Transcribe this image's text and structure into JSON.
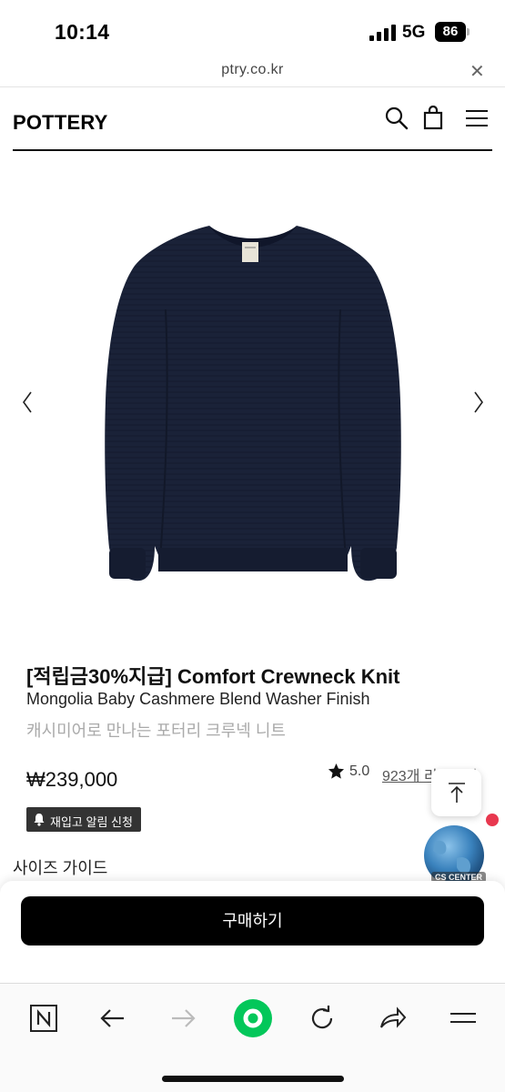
{
  "status_bar": {
    "time": "10:14",
    "network": "5G",
    "battery": "86"
  },
  "url_bar": {
    "domain": "ptry.co.kr",
    "close_glyph": "✕"
  },
  "header": {
    "logo": "POTTERY",
    "icons": [
      "search-icon",
      "shopping-bag-icon",
      "hamburger-menu-icon"
    ]
  },
  "gallery": {
    "image_subject": "navy crewneck knit sweater",
    "prev_glyph": "prev-chevron",
    "next_glyph": "next-chevron"
  },
  "product": {
    "title": "[적립금30%지급] Comfort Crewneck Knit",
    "subtitle": "Mongolia Baby Cashmere Blend Washer Finish",
    "description": "캐시미어로 만나는 포터리 크루넥 니트",
    "price": "₩239,000",
    "rating": "5.0",
    "reviews": "923개 리뷰보기",
    "restock_label": "재입고 알림 신청",
    "size_guide": "사이즈 가이드"
  },
  "widgets": {
    "cs_center": "CS CENTER"
  },
  "purchase": {
    "buy_label": "구매하기"
  },
  "toolbar": {
    "buttons": [
      "naver-n-icon",
      "back-arrow-icon",
      "forward-arrow-icon",
      "green-home-icon",
      "refresh-icon",
      "share-icon",
      "menu-icon"
    ]
  },
  "colors": {
    "accent_green": "#03c75a",
    "sweater_navy": "#1a2238",
    "notify_red": "#e8384f",
    "button_black": "#000000"
  }
}
